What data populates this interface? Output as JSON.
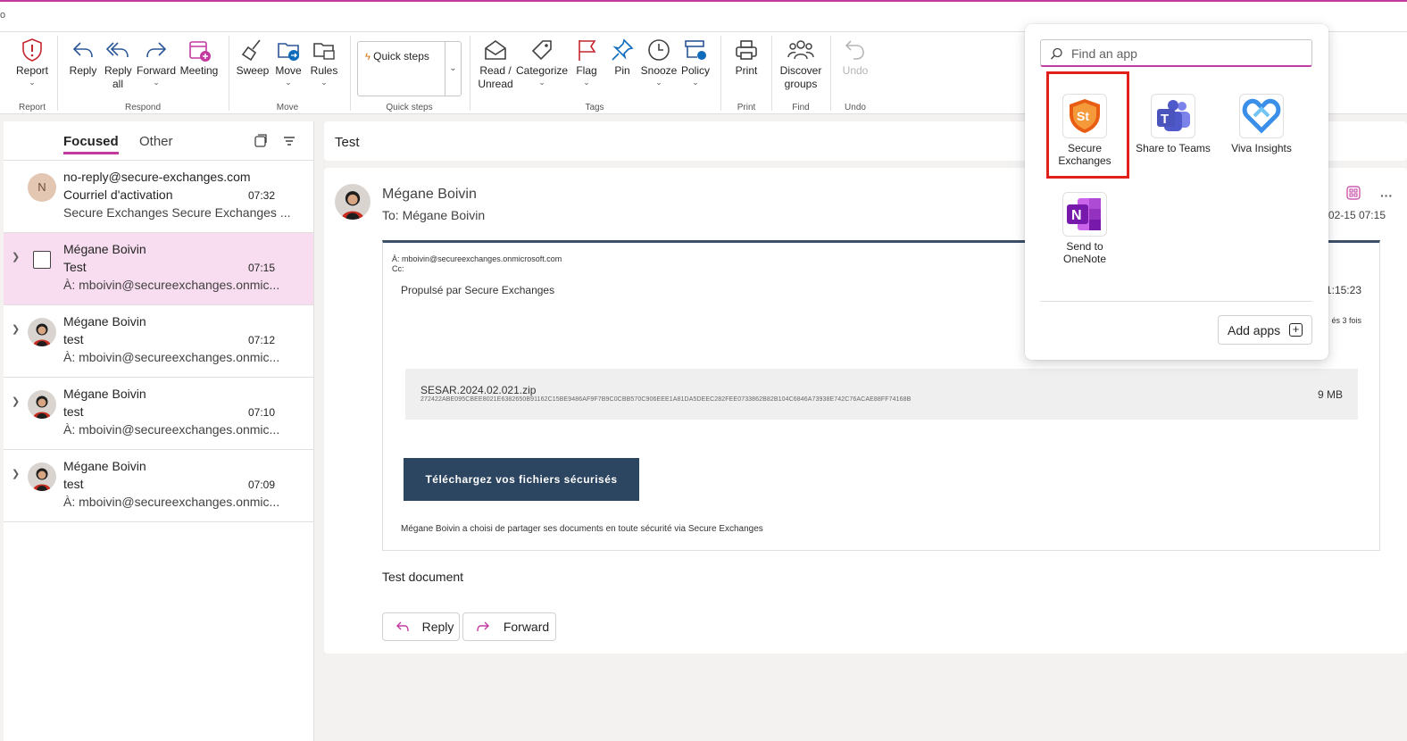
{
  "window": {
    "corner_char": "o"
  },
  "ribbon": {
    "report": {
      "label": "Report",
      "group": "Report"
    },
    "respond": {
      "group": "Respond",
      "reply": "Reply",
      "reply_all": "Reply all",
      "forward": "Forward",
      "meeting": "Meeting"
    },
    "move": {
      "group": "Move",
      "sweep": "Sweep",
      "move": "Move",
      "rules": "Rules"
    },
    "quick_steps": {
      "label": "Quick steps",
      "group": "Quick steps"
    },
    "tags": {
      "group": "Tags",
      "read_unread": "Read / Unread",
      "categorize": "Categorize",
      "flag": "Flag",
      "pin": "Pin",
      "snooze": "Snooze",
      "policy": "Policy"
    },
    "print": {
      "label": "Print",
      "group": "Print"
    },
    "find": {
      "label": "Discover groups",
      "group": "Find"
    },
    "undo": {
      "label": "Undo",
      "group": "Undo"
    }
  },
  "mail_list": {
    "tab_focused": "Focused",
    "tab_other": "Other",
    "items": [
      {
        "sender": "no-reply@secure-exchanges.com",
        "subject": "Courriel d'activation",
        "time": "07:32",
        "preview": "Secure Exchanges Secure Exchanges ...",
        "initial": "N"
      },
      {
        "sender": "Mégane Boivin",
        "subject": "Test",
        "time": "07:15",
        "preview": "À: mboivin@secureexchanges.onmic..."
      },
      {
        "sender": "Mégane Boivin",
        "subject": "test",
        "time": "07:12",
        "preview": "À: mboivin@secureexchanges.onmic..."
      },
      {
        "sender": "Mégane Boivin",
        "subject": "test",
        "time": "07:10",
        "preview": "À: mboivin@secureexchanges.onmic..."
      },
      {
        "sender": "Mégane Boivin",
        "subject": "test",
        "time": "07:09",
        "preview": "À: mboivin@secureexchanges.onmic..."
      }
    ]
  },
  "reading": {
    "subject": "Test",
    "sender": "Mégane Boivin",
    "to_line": "To:  Mégane Boivin",
    "date": "-02-15 07:15",
    "embed": {
      "to_line": "À: mboivin@secureexchanges.onmicrosoft.com",
      "cc_line": "Cc:",
      "powered": "Propulsé par Secure Exchanges",
      "time": "1:15:23",
      "fois": "és 3 fois",
      "file_name": "SESAR.2024.02.021.zip",
      "file_hash": "272422ABE095CBEE8021E6382650B91162C15BE9486AF9F7B9C0CBB570C906EEE1A81DA5DEEC282FEE0733862B82B104C6846A73938E742C76ACAE88FF74168B",
      "file_size": "9 MB",
      "download_button": "Téléchargez vos fichiers sécurisés",
      "footer": "Mégane Boivin a choisi de partager ses documents en toute sécurité via Secure Exchanges"
    },
    "body": "Test document",
    "reply_button": "Reply",
    "forward_button": "Forward",
    "more": "···"
  },
  "app_popup": {
    "search_placeholder": "Find an app",
    "apps": [
      {
        "name": "Secure Exchanges",
        "line1": "Secure",
        "line2": "Exchanges"
      },
      {
        "name": "Share to Teams",
        "line1": "Share to Teams",
        "line2": ""
      },
      {
        "name": "Viva Insights",
        "line1": "Viva Insights",
        "line2": ""
      },
      {
        "name": "Send to OneNote",
        "line1": "Send to",
        "line2": "OneNote"
      }
    ],
    "add_apps": "Add apps"
  },
  "colors": {
    "accent": "#c43ba0",
    "selected_row": "#f8dcef",
    "highlight": "#e2201b",
    "button_dark": "#2c4561"
  }
}
